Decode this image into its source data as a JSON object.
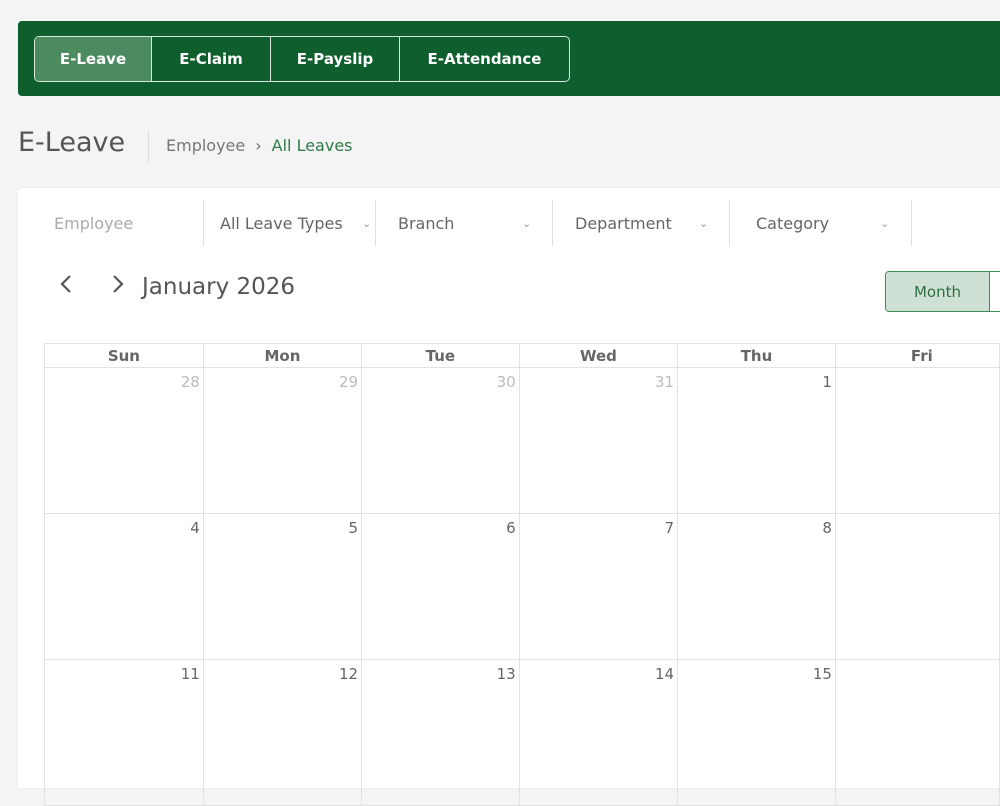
{
  "tabs": [
    {
      "label": "E-Leave",
      "active": true
    },
    {
      "label": "E-Claim",
      "active": false
    },
    {
      "label": "E-Payslip",
      "active": false
    },
    {
      "label": "E-Attendance",
      "active": false
    }
  ],
  "page": {
    "title": "E-Leave",
    "breadcrumb": {
      "parent": "Employee",
      "separator": "›",
      "current": "All Leaves"
    }
  },
  "filters": {
    "employee_placeholder": "Employee",
    "leave_type": "All Leave Types",
    "branch": "Branch",
    "department": "Department",
    "category": "Category"
  },
  "calendar": {
    "month_label": "January 2026",
    "view_month_label": "Month",
    "weekdays": [
      "Sun",
      "Mon",
      "Tue",
      "Wed",
      "Thu",
      "Fri"
    ],
    "weeks": [
      [
        {
          "d": "28",
          "other": true
        },
        {
          "d": "29",
          "other": true
        },
        {
          "d": "30",
          "other": true
        },
        {
          "d": "31",
          "other": true
        },
        {
          "d": "1",
          "other": false
        },
        {
          "d": "",
          "other": false
        }
      ],
      [
        {
          "d": "4",
          "other": false
        },
        {
          "d": "5",
          "other": false
        },
        {
          "d": "6",
          "other": false
        },
        {
          "d": "7",
          "other": false
        },
        {
          "d": "8",
          "other": false
        },
        {
          "d": "",
          "other": false
        }
      ],
      [
        {
          "d": "11",
          "other": false
        },
        {
          "d": "12",
          "other": false
        },
        {
          "d": "13",
          "other": false
        },
        {
          "d": "14",
          "other": false
        },
        {
          "d": "15",
          "other": false
        },
        {
          "d": "",
          "other": false
        }
      ]
    ]
  },
  "colors": {
    "header_green": "#0e5e2e",
    "active_tab": "#4c8a5f",
    "breadcrumb_current": "#2e7a4a",
    "toggle_active_bg": "#cfe1d4"
  },
  "icons": {
    "prev": "chevron-left-icon",
    "next": "chevron-right-icon",
    "dropdown": "chevron-down-icon"
  }
}
